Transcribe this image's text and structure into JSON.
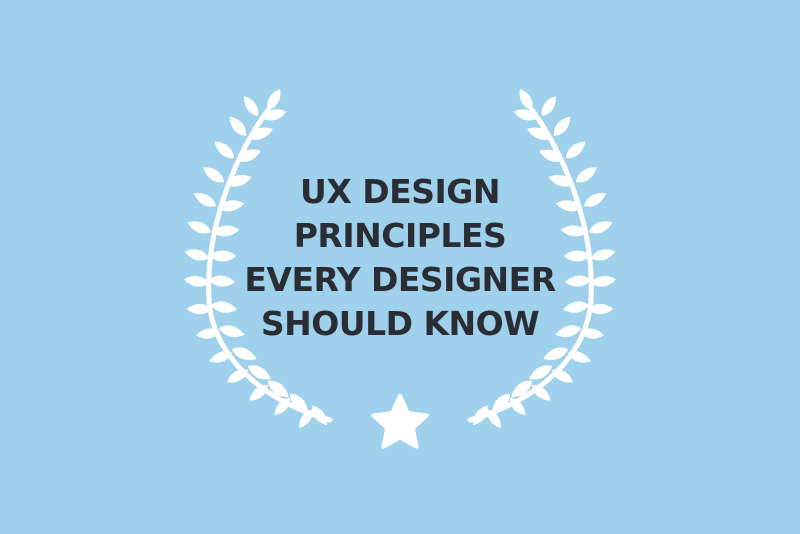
{
  "title": {
    "lines": [
      "UX DESIGN",
      "PRINCIPLES",
      "EVERY DESIGNER",
      "SHOULD KNOW"
    ]
  },
  "icons": {
    "left_branch": "laurel-branch-left-icon",
    "right_branch": "laurel-branch-right-icon",
    "star": "star-icon"
  },
  "colors": {
    "background": "#9fd0ec",
    "text": "#2a2d33",
    "ornament": "#ffffff"
  }
}
